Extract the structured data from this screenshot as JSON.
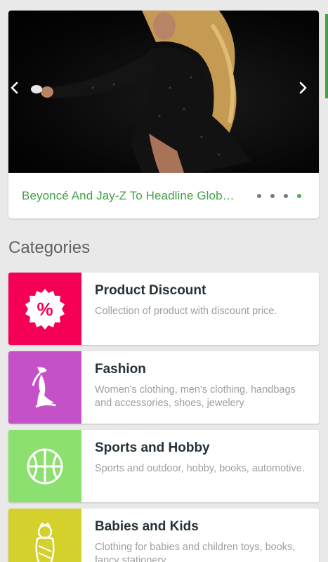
{
  "slider": {
    "caption": "Beyoncé And Jay-Z To Headline Global Citizen Festival",
    "dots_total": 4,
    "active_dot": 4
  },
  "categories": {
    "title": "Categories",
    "items": [
      {
        "title": "Product Discount",
        "description": "Collection of product with discount price.",
        "icon": "percent-badge-icon",
        "color": "#f50057"
      },
      {
        "title": "Fashion",
        "description": "Women's clothing, men's clothing, handbags and accessories, shoes, jewelery",
        "icon": "mannequin-icon",
        "color": "#c451c8"
      },
      {
        "title": "Sports and Hobby",
        "description": "Sports and outdoor, hobby, books, automotive.",
        "icon": "basketball-icon",
        "color": "#8be06f"
      },
      {
        "title": "Babies and Kids",
        "description": "Clothing for babies and children toys, books, fancy stationery",
        "icon": "baby-icon",
        "color": "#d4d02c"
      }
    ]
  },
  "colors": {
    "accent": "#43a047",
    "background": "#e9e9e9"
  }
}
